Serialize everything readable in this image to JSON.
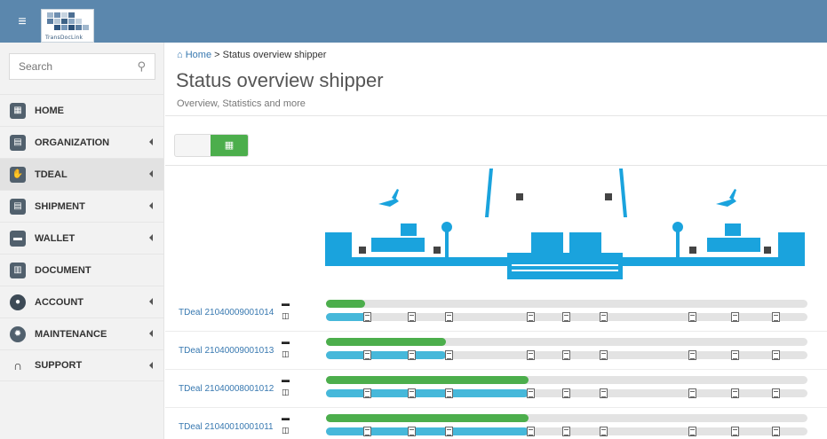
{
  "header": {
    "menu_icon": "hamburger-icon",
    "logo_text": "TransDocLink"
  },
  "sidebar": {
    "search_placeholder": "Search",
    "items": [
      {
        "label": "HOME",
        "icon": "home-icon",
        "has_caret": false
      },
      {
        "label": "ORGANIZATION",
        "icon": "organization-icon",
        "has_caret": true
      },
      {
        "label": "TDEAL",
        "icon": "handshake-icon",
        "has_caret": true,
        "active": true
      },
      {
        "label": "SHIPMENT",
        "icon": "shipment-icon",
        "has_caret": true
      },
      {
        "label": "WALLET",
        "icon": "wallet-icon",
        "has_caret": true
      },
      {
        "label": "DOCUMENT",
        "icon": "document-icon",
        "has_caret": false
      },
      {
        "label": "ACCOUNT",
        "icon": "user-icon",
        "has_caret": true
      },
      {
        "label": "MAINTENANCE",
        "icon": "gear-icon",
        "has_caret": true
      },
      {
        "label": "SUPPORT",
        "icon": "headset-icon",
        "has_caret": true
      }
    ]
  },
  "breadcrumb": {
    "home": "Home",
    "current": "Status overview shipper"
  },
  "page": {
    "title": "Status overview shipper",
    "subtitle": "Overview, Statistics and more"
  },
  "deals": [
    {
      "label": "TDeal 21040009001014",
      "progress": 0.08,
      "blue_progress": 0.09
    },
    {
      "label": "TDeal 21040009001013",
      "progress": 0.25,
      "blue_progress": 0.25
    },
    {
      "label": "TDeal 21040008001012",
      "progress": 0.42,
      "blue_progress": 0.42
    },
    {
      "label": "TDeal 21040010001011",
      "progress": 0.42,
      "blue_progress": 0.42
    }
  ],
  "colors": {
    "topbar": "#5b87ad",
    "green": "#4cae4c",
    "blue": "#46b8da",
    "banner_blue": "#1aa3dd"
  }
}
